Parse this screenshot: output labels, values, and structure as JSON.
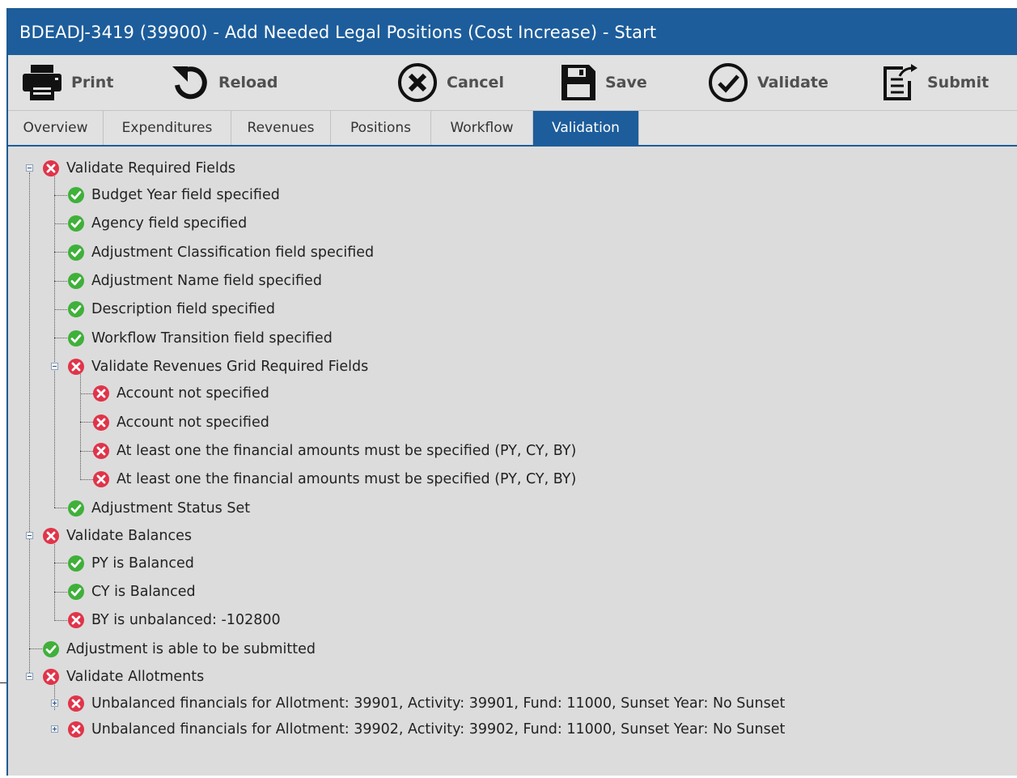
{
  "window": {
    "title": "BDEADJ-3419 (39900) - Add Needed Legal Positions (Cost Increase) - Start"
  },
  "toolbar": {
    "print": "Print",
    "reload": "Reload",
    "cancel": "Cancel",
    "save": "Save",
    "validate": "Validate",
    "submit": "Submit"
  },
  "tabs": [
    "Overview",
    "Expenditures",
    "Revenues",
    "Positions",
    "Workflow",
    "Validation"
  ],
  "active_tab": "Validation",
  "colors": {
    "accent": "#1d5d9b",
    "success": "#3fb03a",
    "error": "#e0344a"
  },
  "tree": [
    {
      "text": "Validate Required Fields",
      "status": "error",
      "expanded": true
    },
    {
      "text": "Budget Year field specified",
      "status": "success"
    },
    {
      "text": "Agency field specified",
      "status": "success"
    },
    {
      "text": "Adjustment Classification field specified",
      "status": "success"
    },
    {
      "text": "Adjustment Name field specified",
      "status": "success"
    },
    {
      "text": "Description field specified",
      "status": "success"
    },
    {
      "text": "Workflow Transition field specified",
      "status": "success"
    },
    {
      "text": "Validate Revenues Grid Required Fields",
      "status": "error",
      "expanded": true
    },
    {
      "text": "Account not specified",
      "status": "error"
    },
    {
      "text": "Account not specified",
      "status": "error"
    },
    {
      "text": "At least one the financial amounts must be specified (PY, CY, BY)",
      "status": "error"
    },
    {
      "text": "At least one the financial amounts must be specified (PY, CY, BY)",
      "status": "error"
    },
    {
      "text": "Adjustment Status Set",
      "status": "success"
    },
    {
      "text": "Validate Balances",
      "status": "error",
      "expanded": true
    },
    {
      "text": "PY is Balanced",
      "status": "success"
    },
    {
      "text": "CY is Balanced",
      "status": "success"
    },
    {
      "text": "BY is unbalanced: -102800",
      "status": "error"
    },
    {
      "text": "Adjustment is able to be submitted",
      "status": "success"
    },
    {
      "text": "Validate Allotments",
      "status": "error",
      "expanded": true
    },
    {
      "text": "Unbalanced financials for Allotment: 39901, Activity: 39901, Fund: 11000, Sunset Year: No Sunset",
      "status": "error",
      "expanded": false
    },
    {
      "text": "Unbalanced financials for Allotment: 39902, Activity: 39902, Fund: 11000, Sunset Year: No Sunset",
      "status": "error",
      "expanded": false
    }
  ]
}
